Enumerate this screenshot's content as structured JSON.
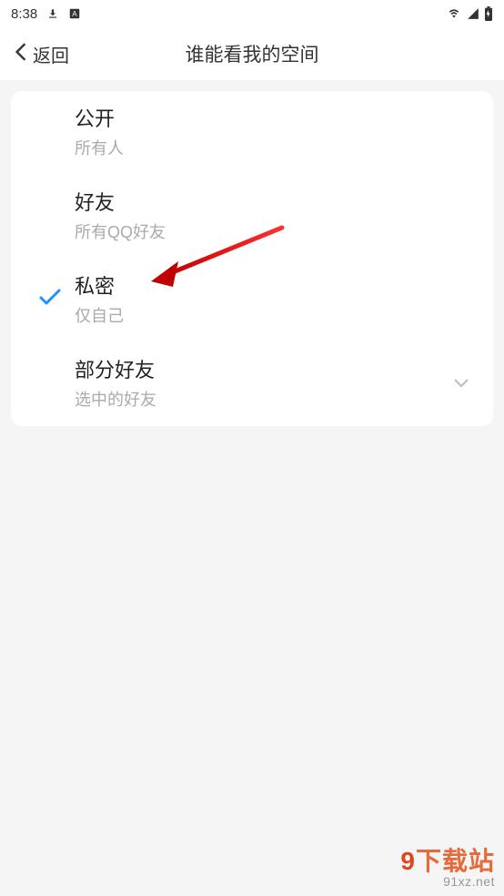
{
  "statusBar": {
    "time": "8:38"
  },
  "header": {
    "backLabel": "返回",
    "title": "谁能看我的空间"
  },
  "options": [
    {
      "title": "公开",
      "subtitle": "所有人",
      "selected": false,
      "expandable": false
    },
    {
      "title": "好友",
      "subtitle": "所有QQ好友",
      "selected": false,
      "expandable": false
    },
    {
      "title": "私密",
      "subtitle": "仅自己",
      "selected": true,
      "expandable": false
    },
    {
      "title": "部分好友",
      "subtitle": "选中的好友",
      "selected": false,
      "expandable": true
    }
  ],
  "watermark": {
    "brand": "下载站",
    "url": "91xz.net"
  }
}
